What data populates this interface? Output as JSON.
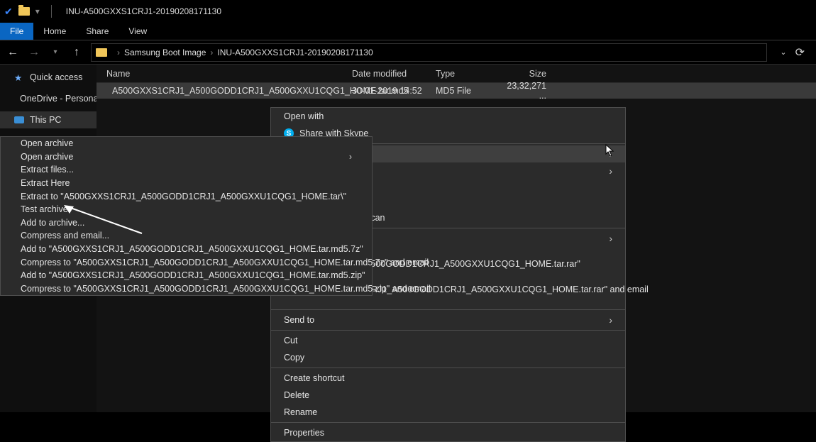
{
  "title": "INU-A500GXXS1CRJ1-20190208171130",
  "ribbon": {
    "file": "File",
    "home": "Home",
    "share": "Share",
    "view": "View"
  },
  "breadcrumb": {
    "a": "Samsung Boot Image",
    "b": "INU-A500GXXS1CRJ1-20190208171130"
  },
  "sidebar": {
    "quick": "Quick access",
    "onedrive": "OneDrive - Personal",
    "pc": "This PC"
  },
  "columns": {
    "name": "Name",
    "date": "Date modified",
    "type": "Type",
    "size": "Size"
  },
  "row": {
    "name": "A500GXXS1CRJ1_A500GODD1CRJ1_A500GXXU1CQG1_HOME.tar.md5",
    "date": "30-01-2019 14:52",
    "type": "MD5 File",
    "size": "23,32,271 ..."
  },
  "ctx_main": {
    "open_with": "Open with",
    "skype": "Share with Skype",
    "scan": "Scan",
    "rar1": "A500GODD1CRJ1_A500GXXU1CQG1_HOME.tar.rar\"",
    "rar2": "CRJ1_A500GODD1CRJ1_A500GXXU1CQG1_HOME.tar.rar\" and email",
    "sendto": "Send to",
    "cut": "Cut",
    "copy": "Copy",
    "shortcut": "Create shortcut",
    "delete": "Delete",
    "rename": "Rename",
    "properties": "Properties"
  },
  "ctx7z": {
    "i0": "Open archive",
    "i1": "Open archive",
    "i2": "Extract files...",
    "i3": "Extract Here",
    "i4": "Extract to \"A500GXXS1CRJ1_A500GODD1CRJ1_A500GXXU1CQG1_HOME.tar\\\"",
    "i5": "Test archive",
    "i6": "Add to archive...",
    "i7": "Compress and email...",
    "i8": "Add to \"A500GXXS1CRJ1_A500GODD1CRJ1_A500GXXU1CQG1_HOME.tar.md5.7z\"",
    "i9": "Compress to \"A500GXXS1CRJ1_A500GODD1CRJ1_A500GXXU1CQG1_HOME.tar.md5.7z\" and email",
    "i10": "Add to \"A500GXXS1CRJ1_A500GODD1CRJ1_A500GXXU1CQG1_HOME.tar.md5.zip\"",
    "i11": "Compress to \"A500GXXS1CRJ1_A500GODD1CRJ1_A500GXXU1CQG1_HOME.tar.md5.zip\" and email"
  }
}
